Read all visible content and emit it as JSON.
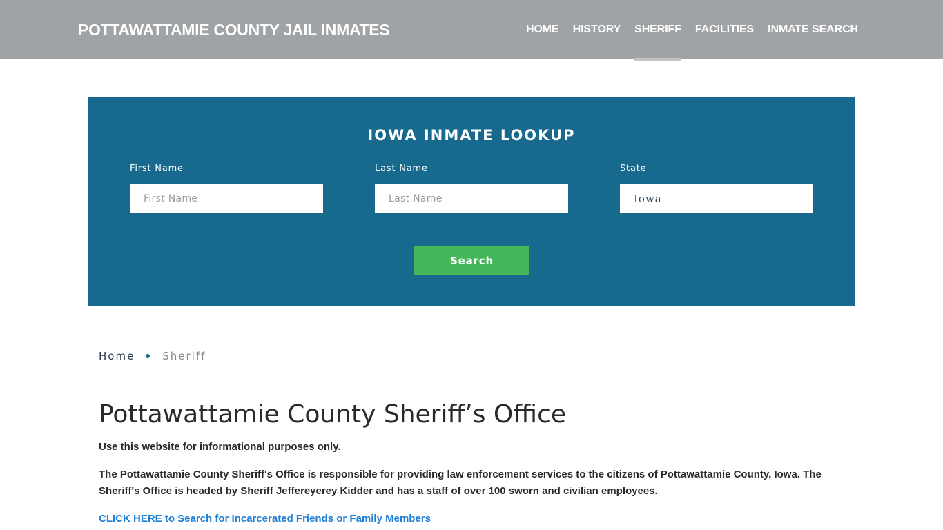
{
  "header": {
    "site_title": "POTTAWATTAMIE COUNTY JAIL INMATES",
    "nav": [
      {
        "label": "HOME",
        "active": false
      },
      {
        "label": "HISTORY",
        "active": false
      },
      {
        "label": "SHERIFF",
        "active": true
      },
      {
        "label": "FACILITIES",
        "active": false
      },
      {
        "label": "INMATE SEARCH",
        "active": false
      }
    ]
  },
  "lookup": {
    "title": "IOWA INMATE LOOKUP",
    "first_name": {
      "label": "First Name",
      "placeholder": "First Name",
      "value": ""
    },
    "last_name": {
      "label": "Last Name",
      "placeholder": "Last Name",
      "value": ""
    },
    "state": {
      "label": "State",
      "value": "Iowa"
    },
    "search_label": "Search",
    "colors": {
      "panel": "#176a8d",
      "button": "#45b75a"
    }
  },
  "breadcrumb": {
    "home": "Home",
    "current": "Sheriff"
  },
  "main": {
    "title": "Pottawattamie County Sheriff’s Office",
    "intro": "Use this website for informational purposes only.",
    "description": "The Pottawattamie County Sheriff's Office is responsible for providing law enforcement services to the citizens of Pottawattamie County, Iowa. The Sheriff's Office is headed by Sheriff Jeffereyerey Kidder and has a staff of over 100 sworn and civilian employees.",
    "cta_link": "CLICK HERE to Search for Incarcerated Friends or Family Members"
  }
}
